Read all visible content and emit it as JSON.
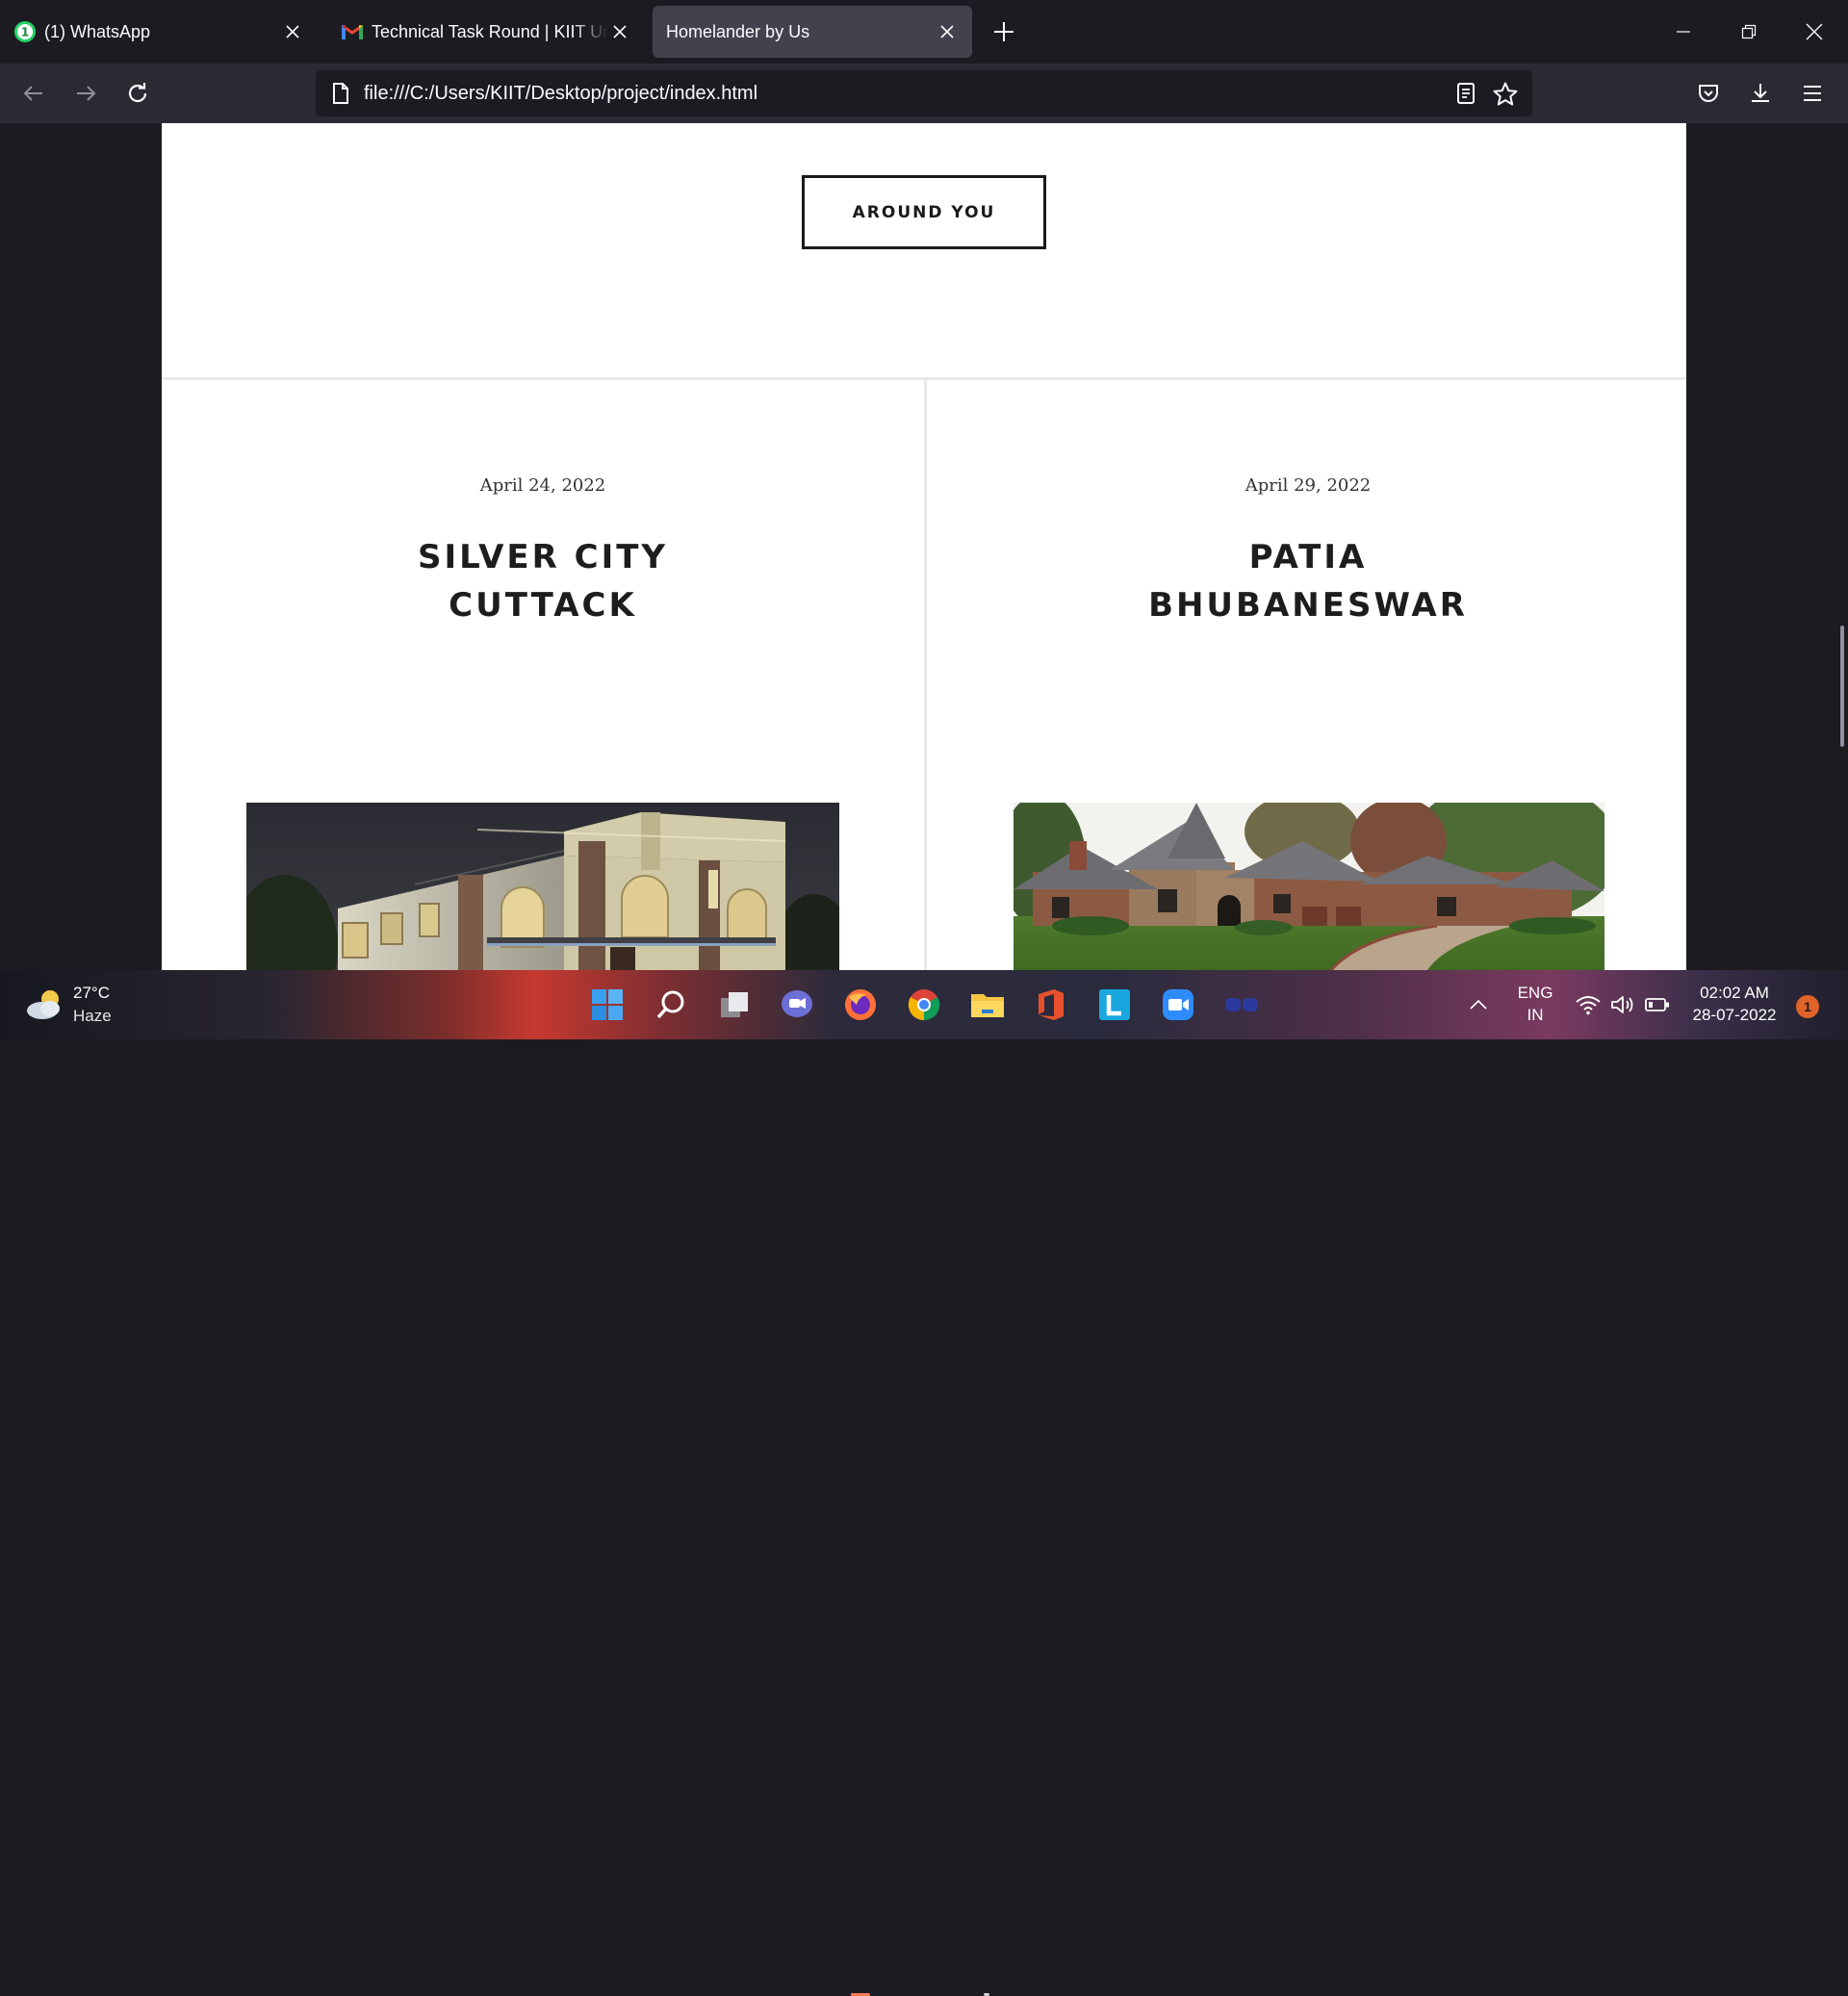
{
  "browser": {
    "tabs": [
      {
        "title": "(1) WhatsApp",
        "favicon": "whatsapp-icon",
        "badge": "1",
        "active": false
      },
      {
        "title": "Technical Task Round | KIIT University",
        "favicon": "gmail-icon",
        "active": false
      },
      {
        "title": "Homelander by Us",
        "favicon": "none",
        "active": true
      }
    ],
    "url": "file:///C:/Users/KIIT/Desktop/project/index.html"
  },
  "page": {
    "cta_label": "AROUND YOU",
    "cards": [
      {
        "date": "April 24, 2022",
        "title_line1": "SILVER CITY",
        "title_line2": "CUTTACK",
        "image": "modern-villa-night"
      },
      {
        "date": "April 29, 2022",
        "title_line1": "PATIA",
        "title_line2": "BHUBANESWAR",
        "image": "stone-cottage-house"
      }
    ]
  },
  "taskbar": {
    "weather": {
      "temp": "27°C",
      "condition": "Haze"
    },
    "language": {
      "line1": "ENG",
      "line2": "IN"
    },
    "clock": {
      "time": "02:02 AM",
      "date": "28-07-2022"
    },
    "notification_count": "1"
  },
  "colors": {
    "accent_firefox": "#ff7139",
    "page_bg": "#ffffff",
    "chrome_bg": "#1c1b22",
    "toolbar_bg": "#2b2a33"
  }
}
